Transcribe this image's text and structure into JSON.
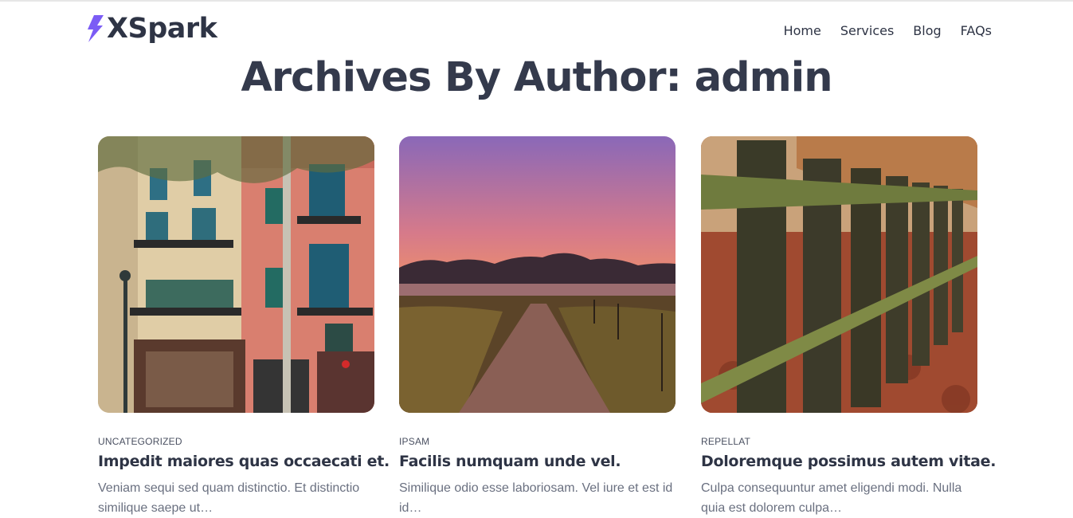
{
  "site": {
    "logo_text": "XSpark",
    "brand_color": "#7b5cf5"
  },
  "nav": {
    "items": [
      {
        "label": "Home"
      },
      {
        "label": "Services"
      },
      {
        "label": "Blog"
      },
      {
        "label": "FAQs"
      }
    ]
  },
  "page": {
    "title": "Archives By Author: admin"
  },
  "posts": [
    {
      "image": "city-building-photo",
      "category": "UNCATEGORIZED",
      "title": "Impedit maiores quas occaecati et.",
      "excerpt": "Veniam sequi sed quam distinctio. Et distinctio similique saepe ut…"
    },
    {
      "image": "sunset-path-photo",
      "category": "IPSAM",
      "title": "Facilis numquam unde vel.",
      "excerpt": "Similique odio esse laboriosam. Vel iure et est id id…"
    },
    {
      "image": "wooden-fence-photo",
      "category": "REPELLAT",
      "title": "Doloremque possimus autem vitae.",
      "excerpt": "Culpa consequuntur amet eligendi modi. Nulla quia est dolorem culpa…"
    }
  ]
}
